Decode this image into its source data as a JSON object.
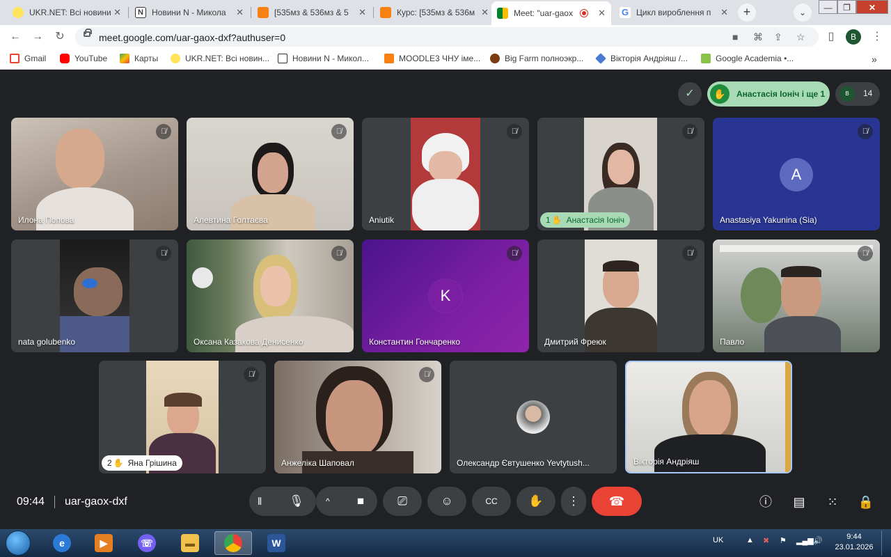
{
  "tabs": [
    {
      "title": "UKR.NET: Всі новини",
      "close": "✕"
    },
    {
      "title": "Новини N - Микола",
      "close": "✕"
    },
    {
      "title": "[535мз & 536мз & 5",
      "close": "✕"
    },
    {
      "title": "Курс: [535мз & 536м",
      "close": "✕"
    },
    {
      "title": "Meet: \"uar-gaox",
      "close": "✕"
    },
    {
      "title": "Цикл вироблення п",
      "close": "✕"
    }
  ],
  "new_tab": "+",
  "tab_search": "⌄",
  "url": "meet.google.com/uar-gaox-dxf?authuser=0",
  "profile_initial": "B",
  "bookmarks": [
    "Gmail",
    "YouTube",
    "Карты",
    "UKR.NET: Всі новин...",
    "Новини N - Микол...",
    "MOODLE3 ЧНУ імe...",
    "Big Farm полноэкр...",
    "Вікторія Андріяш /...",
    "Google Academia •..."
  ],
  "bookmarks_more": "»",
  "meet": {
    "hand_raised_text": "Анастасія Іоніч і ще 1",
    "participants_count": "14",
    "people_avatar": "B",
    "tiles": [
      {
        "name": "Илона Попова"
      },
      {
        "name": "Алевтина Голтаєва"
      },
      {
        "name": "Aniutik"
      },
      {
        "name": "Анастасія Іоніч",
        "hand_order": "1"
      },
      {
        "name": "Anastasiya Yakunina (Sia)",
        "avatar_letter": "A"
      },
      {
        "name": "nata golubenko"
      },
      {
        "name": "Оксана Казакова Денисенко"
      },
      {
        "name": "Константин Гончаренко",
        "avatar_letter": "K"
      },
      {
        "name": "Дмитрий Фреюк"
      },
      {
        "name": "Павло"
      },
      {
        "name": "Яна Грішина",
        "hand_order": "2"
      },
      {
        "name": "Анжеліка Шаповал"
      },
      {
        "name": "Олександр Євтушенко Yevtytush..."
      },
      {
        "name": "Вікторія Андріяш"
      }
    ],
    "time": "09:44",
    "meeting_code": "uar-gaox-dxf"
  },
  "taskbar": {
    "lang": "UK",
    "time": "9:44",
    "date": "23.01.2026"
  },
  "colors": {
    "meet_bg": "#202124",
    "tile_bg": "#3c4043",
    "end_call": "#ea4335",
    "hand_pill": "#a8dab5",
    "avatar_blue": "#5c6bc0",
    "purple_tile": "#6a1b9a"
  }
}
